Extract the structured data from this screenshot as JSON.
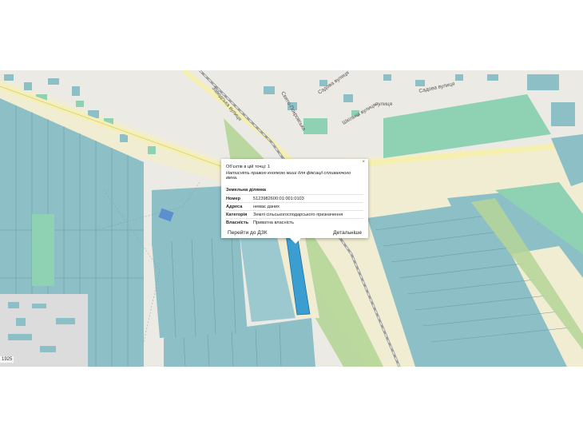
{
  "map": {
    "street_labels": [
      "Заводська вулиця",
      "Свято-Покровська",
      "Садова вулиця",
      "Шкільна вулиця",
      "вулиця",
      "Садова вулиця"
    ],
    "scale_text": "1925",
    "colors": {
      "background": "#eceae4",
      "parcel_fill": "#8dbfc6",
      "parcel_green": "#8fd1b3",
      "agri_tan": "#f1edd3",
      "road_yellow": "#f6f0b0",
      "field_green": "#b5d597",
      "selected_parcel": "#3a9fd0",
      "rail": "#9c9c9c"
    }
  },
  "popup": {
    "header": "Об'єктів в цій точці: 1",
    "hint": "Натисніть правою кнопкою миші для фіксації спливаючого вікна.",
    "section_title": "Земельна ділянка",
    "fields": [
      {
        "key": "Номер",
        "value": "5123982600:01:001:0103"
      },
      {
        "key": "Адреса",
        "value": "немає даних"
      },
      {
        "key": "Категорія",
        "value": "Землі сільськогосподарського призначення"
      },
      {
        "key": "Власність",
        "value": "Приватна власність"
      }
    ],
    "goto_label": "Перейти до ДЗК",
    "details_label": "Детальніше",
    "close_glyph": "×"
  }
}
